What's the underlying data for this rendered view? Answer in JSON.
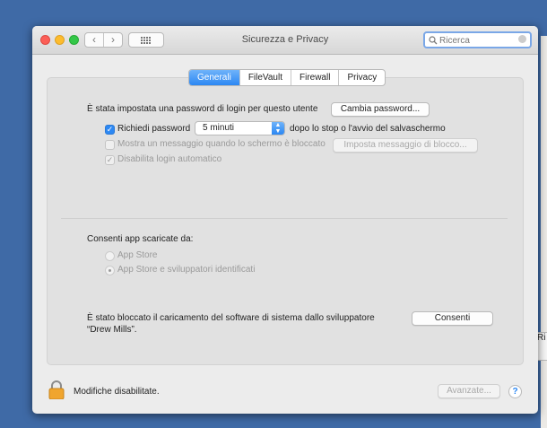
{
  "window": {
    "title": "Sicurezza e Privacy",
    "search": {
      "placeholder": "Ricerca",
      "value": ""
    }
  },
  "tabs": [
    {
      "label": "Generali",
      "active": true
    },
    {
      "label": "FileVault",
      "active": false
    },
    {
      "label": "Firewall",
      "active": false
    },
    {
      "label": "Privacy",
      "active": false
    }
  ],
  "general": {
    "password_set_text": "È stata impostata una password di login per questo utente",
    "change_password_button": "Cambia password...",
    "require_password": {
      "label": "Richiedi password",
      "checked": true
    },
    "require_password_delay": "5 minuti",
    "require_password_suffix": "dopo lo stop o l'avvio del salvaschermo",
    "show_message": {
      "label": "Mostra un messaggio quando lo schermo è bloccato",
      "checked": false,
      "enabled": false
    },
    "set_lock_message_button": "Imposta messaggio di blocco...",
    "disable_auto_login": {
      "label": "Disabilita login automatico",
      "checked": true,
      "enabled": false
    }
  },
  "apps": {
    "heading": "Consenti app scaricate da:",
    "options": [
      {
        "label": "App Store",
        "selected": false
      },
      {
        "label": "App Store e sviluppatori identificati",
        "selected": true
      }
    ]
  },
  "blocked": {
    "line1": "È stato bloccato il caricamento del software di sistema dallo sviluppatore",
    "line2": "“Drew Mills”.",
    "allow_button": "Consenti"
  },
  "footer": {
    "lock_text": "Modifiche disabilitate.",
    "advanced_button": "Avanzate...",
    "help": "?"
  },
  "background_window": {
    "fragment": "Ri"
  },
  "colors": {
    "accent": "#2b87f3",
    "desktop": "#3f6aa6"
  }
}
